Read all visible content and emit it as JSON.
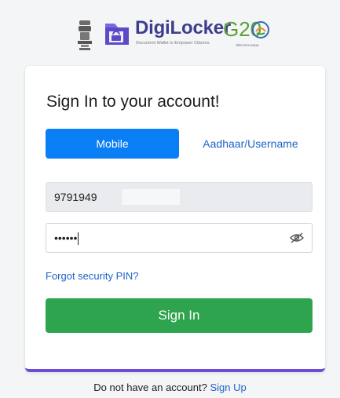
{
  "header": {
    "brand_name": "DigiLocker",
    "tagline": "Document Wallet to Empower Citizens",
    "g20_text": "G20",
    "g20_sub": "भारत 2023 INDIA"
  },
  "card": {
    "title": "Sign In to your account!",
    "tabs": [
      {
        "label": "Mobile",
        "active": true
      },
      {
        "label": "Aadhaar/Username",
        "active": false
      }
    ],
    "mobile_value": "9791949",
    "pin_value": "••••••",
    "forgot_label": "Forgot security PIN?",
    "signin_label": "Sign In"
  },
  "footer": {
    "prompt": "Do not have an account?",
    "signup_label": "Sign Up"
  },
  "colors": {
    "primary_blue": "#0a7ff5",
    "link_blue": "#1c63c9",
    "signin_green": "#2ea44f",
    "accent_purple": "#6c4bd8",
    "brand_navy": "#3d3d8f"
  },
  "icons": [
    "national-emblem-icon",
    "digilocker-logo-icon",
    "g20-globe-icon",
    "eye-slash-icon"
  ]
}
